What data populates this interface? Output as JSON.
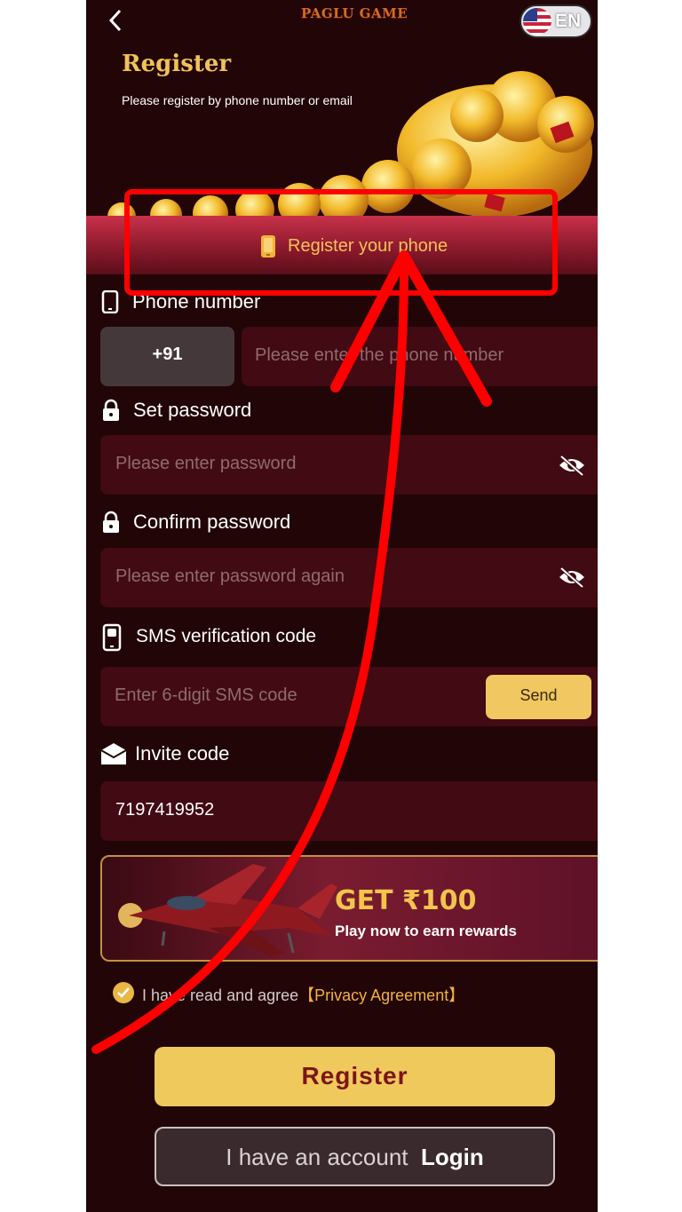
{
  "header": {
    "logo_text": "PAGLU GAME",
    "language": "EN",
    "back_icon": "chevron-left-icon",
    "flag_icon": "us-flag-icon"
  },
  "hero": {
    "title": "Register",
    "subtitle": "Please register by phone number or email"
  },
  "tabs": [
    {
      "label": "Register your phone",
      "icon": "smartphone-icon",
      "active": true
    }
  ],
  "form": {
    "phone": {
      "label": "Phone number",
      "icon": "phone-icon",
      "country_code": "+91",
      "placeholder": "Please enter the phone number"
    },
    "password": {
      "label": "Set password",
      "icon": "lock-icon",
      "placeholder": "Please enter password",
      "toggle_icon": "eye-off-icon"
    },
    "confirm_password": {
      "label": "Confirm password",
      "icon": "lock-icon",
      "placeholder": "Please enter password again",
      "toggle_icon": "eye-off-icon"
    },
    "sms": {
      "label": "SMS verification code",
      "icon": "sms-phone-icon",
      "placeholder": "Enter 6-digit SMS code",
      "send_label": "Send"
    },
    "invite": {
      "label": "Invite code",
      "icon": "envelope-icon",
      "value": "7197419952"
    }
  },
  "banner": {
    "title": "GET ₹100",
    "subtitle": "Play now to earn rewards",
    "image": "jet-plane-icon"
  },
  "agreement": {
    "text": "I have read and agree",
    "link": "【Privacy Agreement】",
    "checked": true
  },
  "actions": {
    "register_label": "Register",
    "login_prefix": "I have an account",
    "login_label": "Login"
  },
  "colors": {
    "background": "#220507",
    "accent_gold": "#efc95c",
    "input_bg": "#420a12",
    "annotation_red": "#ff0000"
  }
}
